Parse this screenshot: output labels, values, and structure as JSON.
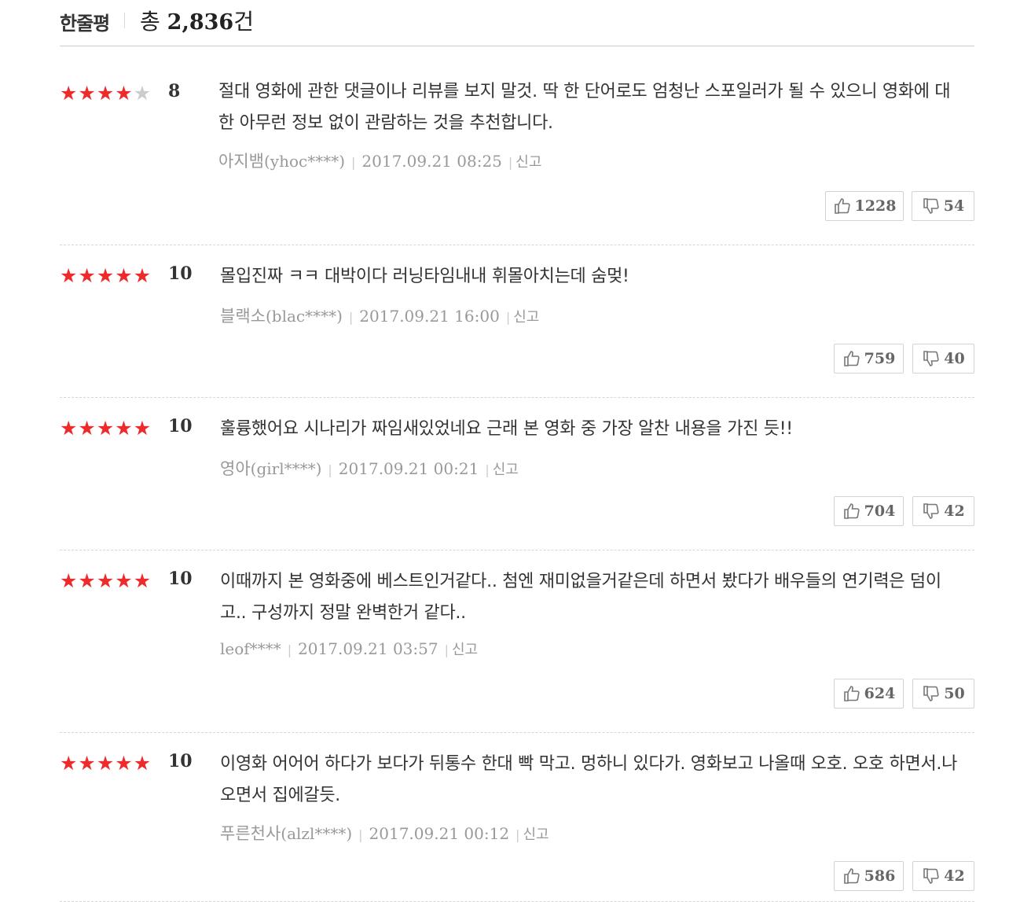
{
  "header": {
    "title": "한줄평",
    "total_prefix": "총",
    "total_count": "2,836",
    "total_suffix": "건"
  },
  "colors": {
    "star_on": "#ee2a2a",
    "star_off": "#cccccc"
  },
  "reviews": [
    {
      "stars": 4,
      "score": "8",
      "text": "절대 영화에 관한 댓글이나 리뷰를 보지 말것. 딱 한 단어로도 엄청난 스포일러가 될 수 있으니 영화에 대한 아무런 정보 없이 관람하는 것을 추천합니다.",
      "nickname": "아지뱀",
      "user_id": "(yhoc****)",
      "date": "2017.09.21 08:25",
      "report": "신고",
      "likes": "1228",
      "dislikes": "54"
    },
    {
      "stars": 5,
      "score": "10",
      "text": "몰입진짜 ㅋㅋ 대박이다 러닝타임내내 휘몰아치는데 숨멎!",
      "nickname": "블랙소",
      "user_id": "(blac****)",
      "date": "2017.09.21 16:00",
      "report": "신고",
      "likes": "759",
      "dislikes": "40"
    },
    {
      "stars": 5,
      "score": "10",
      "text": "훌륭했어요 시나리가 짜임새있었네요 근래 본 영화 중 가장 알찬 내용을 가진 듯!!",
      "nickname": "영아",
      "user_id": "(girl****)",
      "date": "2017.09.21 00:21",
      "report": "신고",
      "likes": "704",
      "dislikes": "42"
    },
    {
      "stars": 5,
      "score": "10",
      "text": "이때까지 본 영화중에 베스트인거같다.. 첨엔 재미없을거같은데 하면서 봤다가 배우들의 연기력은 덤이고.. 구성까지 정말 완벽한거 같다..",
      "nickname": "",
      "user_id": "leof****",
      "date": "2017.09.21 03:57",
      "report": "신고",
      "likes": "624",
      "dislikes": "50"
    },
    {
      "stars": 5,
      "score": "10",
      "text": "이영화 어어어 하다가 보다가 뒤통수 한대 빡 막고. 멍하니 있다가. 영화보고 나올때 오호. 오호 하면서.나오면서 집에갈듯.",
      "nickname": "푸른천사",
      "user_id": "(alzl****)",
      "date": "2017.09.21 00:12",
      "report": "신고",
      "likes": "586",
      "dislikes": "42"
    }
  ]
}
